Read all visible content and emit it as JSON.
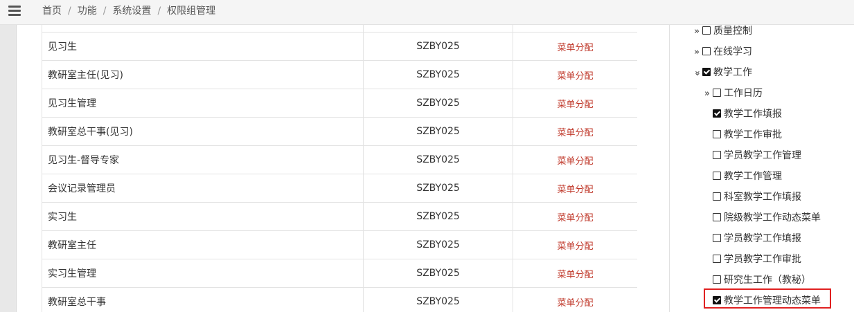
{
  "breadcrumb": {
    "items": [
      "首页",
      "功能",
      "系统设置",
      "权限组管理"
    ],
    "separator": "/"
  },
  "table": {
    "action_label": "菜单分配",
    "rows": [
      {
        "name": "见习生",
        "code": "SZBY025"
      },
      {
        "name": "教研室主任(见习)",
        "code": "SZBY025"
      },
      {
        "name": "见习生管理",
        "code": "SZBY025"
      },
      {
        "name": "教研室总干事(见习)",
        "code": "SZBY025"
      },
      {
        "name": "见习生-督导专家",
        "code": "SZBY025"
      },
      {
        "name": "会议记录管理员",
        "code": "SZBY025"
      },
      {
        "name": "实习生",
        "code": "SZBY025"
      },
      {
        "name": "教研室主任",
        "code": "SZBY025"
      },
      {
        "name": "实习生管理",
        "code": "SZBY025"
      },
      {
        "name": "教研室总干事",
        "code": "SZBY025"
      }
    ]
  },
  "tree": {
    "nodes": [
      {
        "label": "质量控制",
        "arrow": "»",
        "checked": false
      },
      {
        "label": "在线学习",
        "arrow": "»",
        "checked": false
      },
      {
        "label": "教学工作",
        "arrow": "expanded",
        "checked": true
      },
      {
        "label": "工作日历",
        "arrow": "»",
        "checked": false
      },
      {
        "label": "教学工作填报",
        "checked": true
      },
      {
        "label": "教学工作审批",
        "checked": false
      },
      {
        "label": "学员教学工作管理",
        "checked": false
      },
      {
        "label": "教学工作管理",
        "checked": false
      },
      {
        "label": "科室教学工作填报",
        "checked": false
      },
      {
        "label": "院级教学工作动态菜单",
        "checked": false
      },
      {
        "label": "学员教学工作填报",
        "checked": false
      },
      {
        "label": "学员教学工作审批",
        "checked": false
      },
      {
        "label": "研究生工作（教秘）",
        "checked": false
      },
      {
        "label": "教学工作管理动态菜单",
        "checked": true,
        "highlighted": true
      }
    ]
  },
  "colors": {
    "link": "#c0392b",
    "highlight_border": "#e02020"
  }
}
